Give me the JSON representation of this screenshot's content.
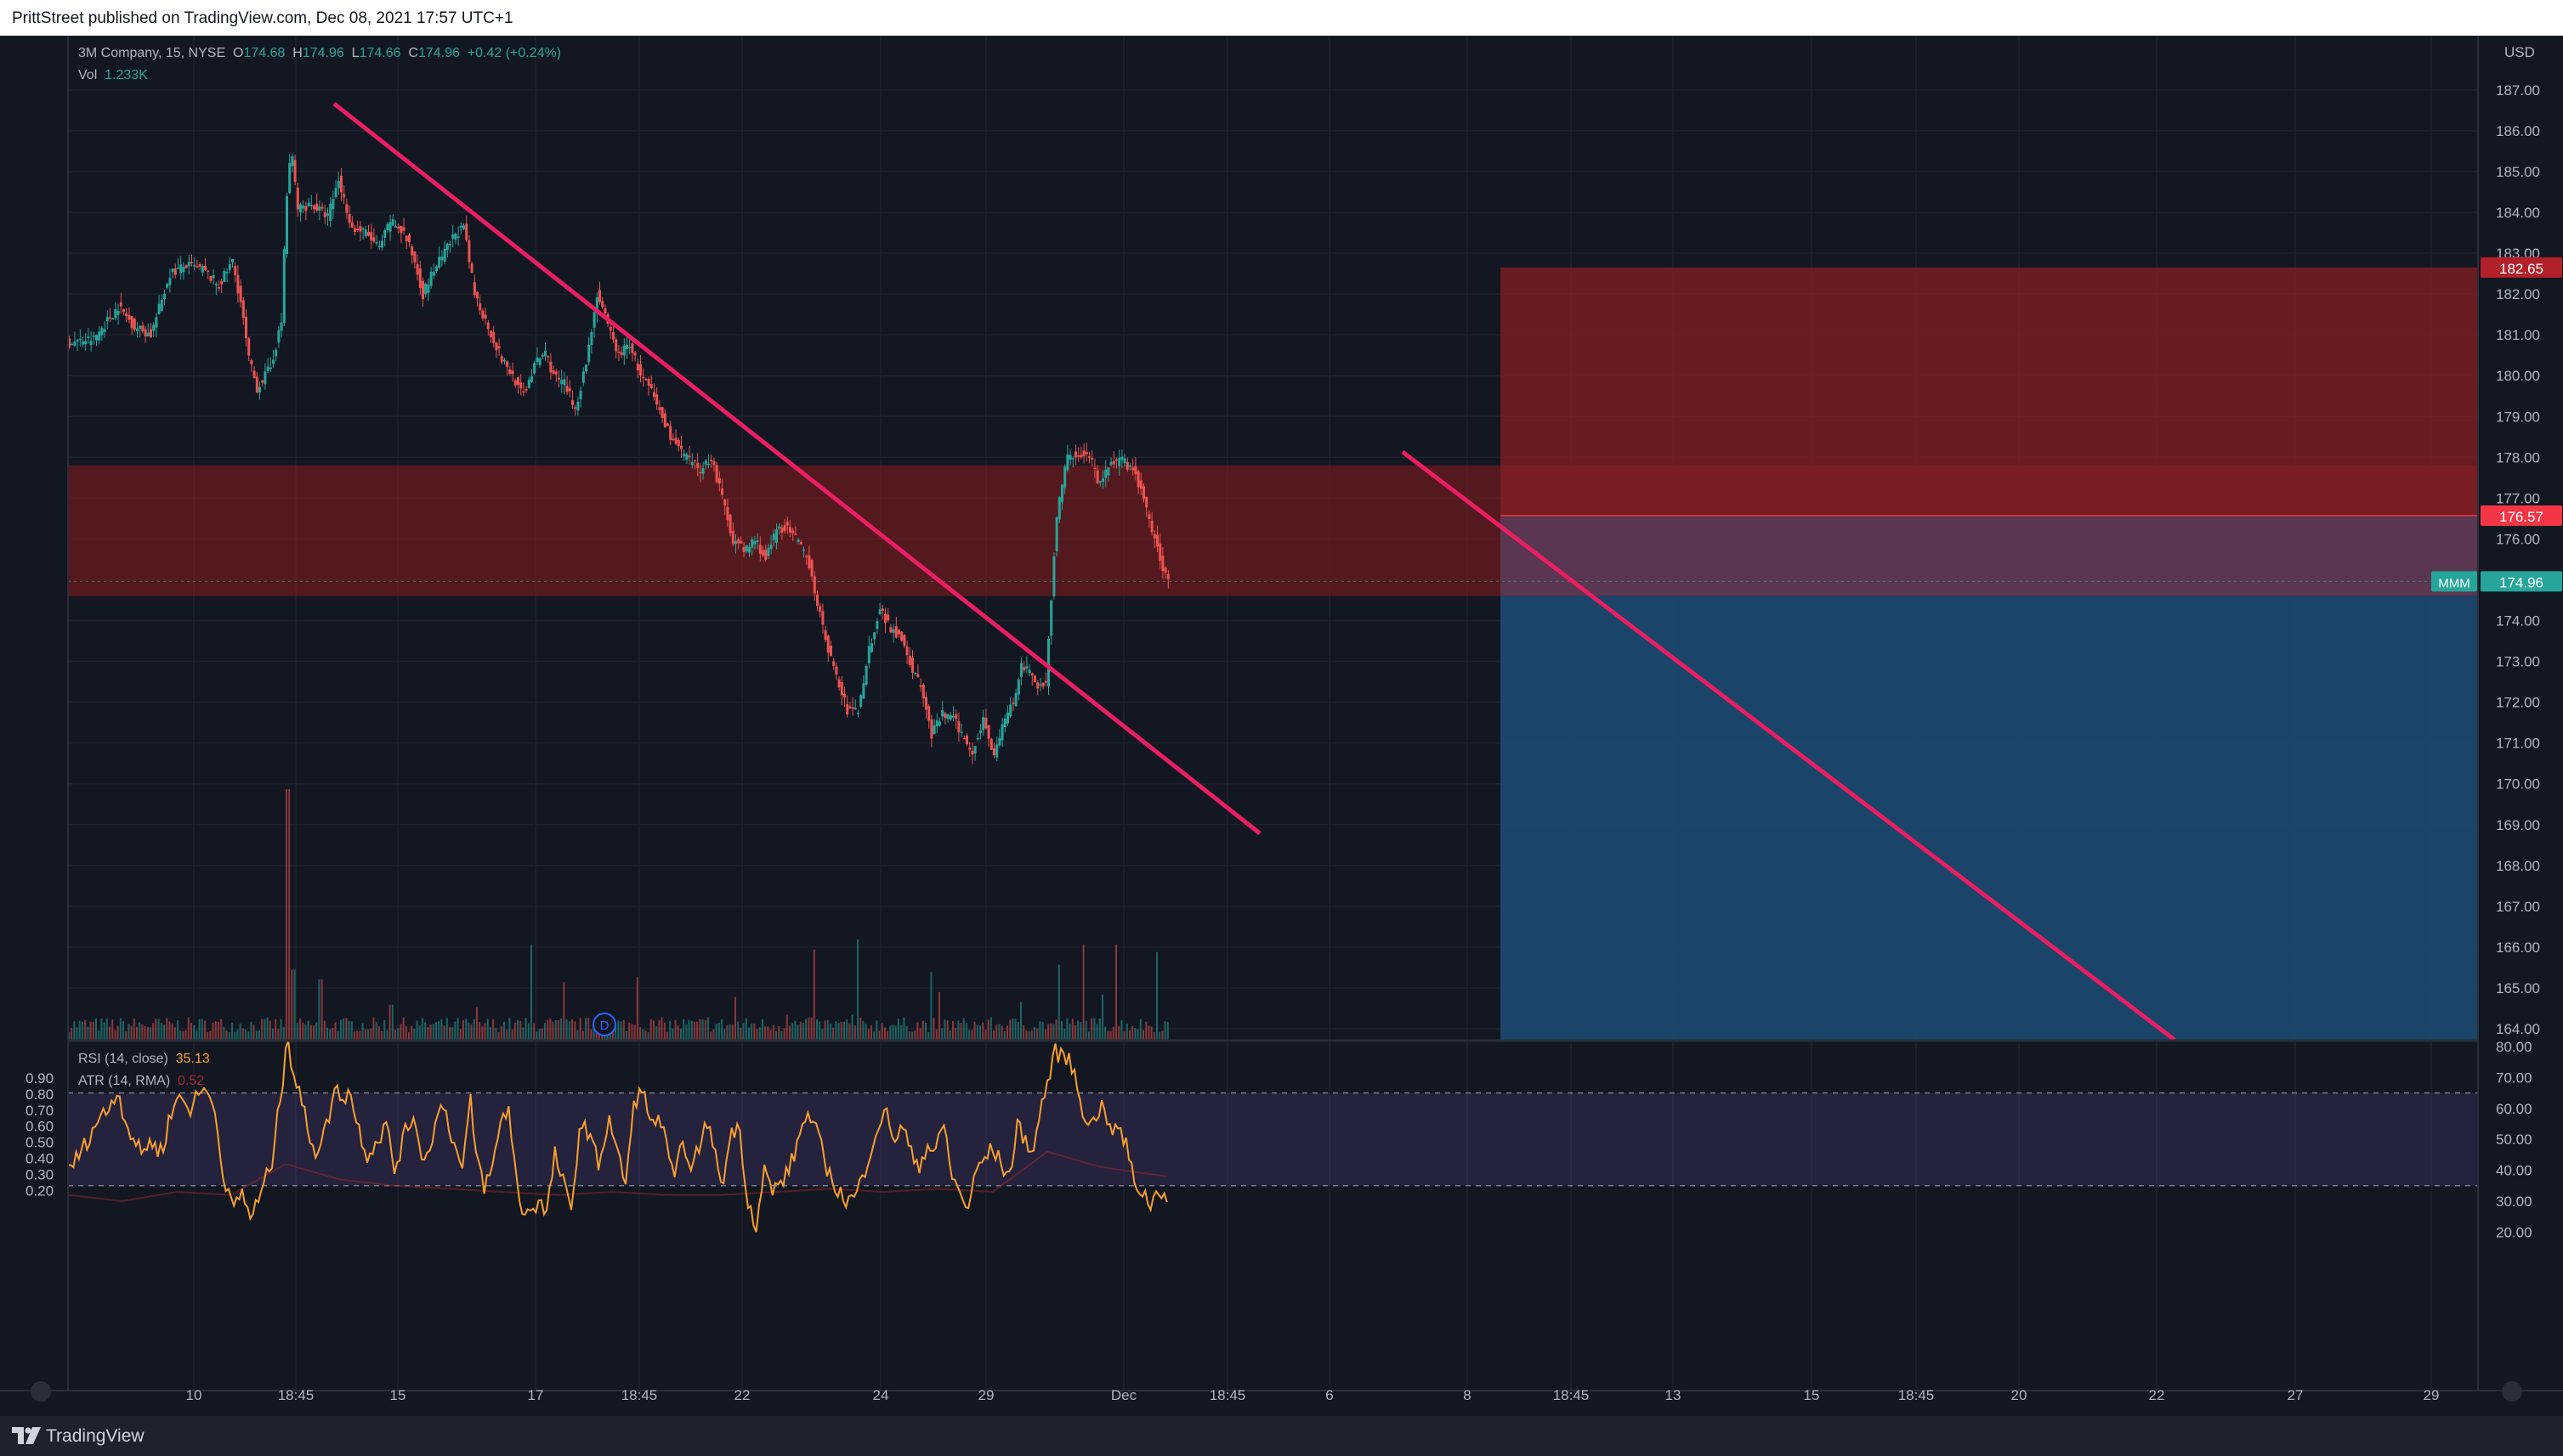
{
  "header": {
    "published": "PrittStreet published on TradingView.com, Dec 08, 2021 17:57 UTC+1"
  },
  "footer": {
    "brand": "TradingView"
  },
  "legend": {
    "symbol_line": "3M Company, 15, NYSE",
    "o_label": "O",
    "o": "174.68",
    "h_label": "H",
    "h": "174.96",
    "l_label": "L",
    "l": "174.66",
    "c_label": "C",
    "c": "174.96",
    "change": "+0.42 (+0.24%)",
    "vol_label": "Vol",
    "vol": "1.233K",
    "rsi_label": "RSI (14, close)",
    "rsi": "35.13",
    "atr_label": "ATR (14, RMA)",
    "atr": "0.52"
  },
  "colors": {
    "up": "#26a69a",
    "down": "#ef5350",
    "trendline": "#e91e63",
    "rsi": "#f7a02d",
    "stop_zone": "#811e24",
    "target_zone": "#1c4a70",
    "resistance_band": "#801a1d"
  },
  "chart_data": {
    "type": "candlestick",
    "symbol": "MMM",
    "currency": "USD",
    "y_range": [
      163.7,
      187.6
    ],
    "price_ticks": [
      "187.00",
      "186.00",
      "185.00",
      "184.00",
      "183.00",
      "182.00",
      "181.00",
      "180.00",
      "179.00",
      "178.00",
      "177.00",
      "176.00",
      "175.00",
      "174.00",
      "173.00",
      "172.00",
      "171.00",
      "170.00",
      "169.00",
      "168.00",
      "167.00",
      "166.00",
      "165.00",
      "164.00"
    ],
    "price_labels": [
      {
        "label": "182.65",
        "price": 182.65,
        "color": "#b2202a"
      },
      {
        "label": "176.57",
        "price": 176.57,
        "color": "#f23645"
      },
      {
        "label": "174.96",
        "price": 174.96,
        "color": "#26a69a",
        "tag": "MMM"
      }
    ],
    "x_ticks": [
      "10",
      "18:45",
      "15",
      "17",
      "18:45",
      "22",
      "24",
      "29",
      "Dec",
      "18:45",
      "6",
      "8",
      "18:45",
      "13",
      "15",
      "18:45",
      "20",
      "22",
      "27",
      "29"
    ],
    "price_path": [
      [
        0,
        180.8
      ],
      [
        20,
        180.9
      ],
      [
        38,
        181.7
      ],
      [
        50,
        181.2
      ],
      [
        62,
        181.0
      ],
      [
        76,
        182.5
      ],
      [
        88,
        182.7
      ],
      [
        100,
        182.6
      ],
      [
        112,
        182.2
      ],
      [
        122,
        182.8
      ],
      [
        128,
        181.8
      ],
      [
        134,
        180.4
      ],
      [
        140,
        179.7
      ],
      [
        150,
        180.2
      ],
      [
        158,
        181.3
      ],
      [
        161,
        184.0
      ],
      [
        165,
        185.6
      ],
      [
        170,
        184.1
      ],
      [
        180,
        184.2
      ],
      [
        192,
        183.9
      ],
      [
        200,
        184.8
      ],
      [
        210,
        183.6
      ],
      [
        220,
        183.5
      ],
      [
        230,
        183.1
      ],
      [
        238,
        183.8
      ],
      [
        248,
        183.5
      ],
      [
        256,
        182.8
      ],
      [
        262,
        182.0
      ],
      [
        270,
        182.6
      ],
      [
        278,
        183.0
      ],
      [
        286,
        183.5
      ],
      [
        292,
        183.6
      ],
      [
        300,
        182.0
      ],
      [
        310,
        181.2
      ],
      [
        320,
        180.4
      ],
      [
        328,
        180.0
      ],
      [
        335,
        179.5
      ],
      [
        345,
        180.3
      ],
      [
        352,
        180.6
      ],
      [
        358,
        180.0
      ],
      [
        366,
        179.8
      ],
      [
        374,
        179.2
      ],
      [
        382,
        180.3
      ],
      [
        390,
        182.0
      ],
      [
        398,
        181.2
      ],
      [
        406,
        180.5
      ],
      [
        414,
        180.8
      ],
      [
        422,
        180.0
      ],
      [
        430,
        179.6
      ],
      [
        440,
        178.8
      ],
      [
        448,
        178.3
      ],
      [
        458,
        177.9
      ],
      [
        466,
        177.7
      ],
      [
        474,
        178.0
      ],
      [
        490,
        176.0
      ],
      [
        498,
        175.7
      ],
      [
        506,
        176.0
      ],
      [
        514,
        175.5
      ],
      [
        522,
        176.2
      ],
      [
        528,
        176.3
      ],
      [
        536,
        176.0
      ],
      [
        546,
        175.4
      ],
      [
        556,
        173.8
      ],
      [
        566,
        172.6
      ],
      [
        574,
        171.8
      ],
      [
        582,
        171.8
      ],
      [
        590,
        173.3
      ],
      [
        598,
        174.3
      ],
      [
        606,
        173.8
      ],
      [
        614,
        173.6
      ],
      [
        622,
        172.8
      ],
      [
        628,
        172.4
      ],
      [
        636,
        171.2
      ],
      [
        644,
        171.7
      ],
      [
        652,
        171.6
      ],
      [
        660,
        171.1
      ],
      [
        666,
        170.8
      ],
      [
        674,
        171.6
      ],
      [
        682,
        170.7
      ],
      [
        690,
        171.6
      ],
      [
        696,
        172.0
      ],
      [
        702,
        172.9
      ],
      [
        708,
        172.7
      ],
      [
        714,
        172.4
      ],
      [
        720,
        172.5
      ],
      [
        728,
        176.6
      ],
      [
        736,
        178.0
      ],
      [
        744,
        178.1
      ],
      [
        752,
        178.0
      ],
      [
        760,
        177.3
      ],
      [
        768,
        177.9
      ],
      [
        776,
        177.9
      ],
      [
        784,
        177.7
      ],
      [
        790,
        177.2
      ],
      [
        796,
        176.4
      ],
      [
        802,
        175.8
      ],
      [
        808,
        175.1
      ]
    ],
    "volume_peaks": [
      [
        161,
        1.0
      ],
      [
        165,
        0.28
      ],
      [
        185,
        0.24
      ],
      [
        237,
        0.14
      ],
      [
        300,
        0.13
      ],
      [
        340,
        0.38
      ],
      [
        364,
        0.23
      ],
      [
        418,
        0.25
      ],
      [
        470,
        0.09
      ],
      [
        490,
        0.17
      ],
      [
        528,
        0.1
      ],
      [
        548,
        0.36
      ],
      [
        576,
        0.1
      ],
      [
        580,
        0.4
      ],
      [
        634,
        0.27
      ],
      [
        640,
        0.19
      ],
      [
        700,
        0.15
      ],
      [
        728,
        0.3
      ],
      [
        746,
        0.38
      ],
      [
        760,
        0.18
      ],
      [
        770,
        0.38
      ],
      [
        800,
        0.35
      ]
    ],
    "rsi_path": [
      [
        0,
        40
      ],
      [
        10,
        46
      ],
      [
        20,
        55
      ],
      [
        30,
        60
      ],
      [
        36,
        66
      ],
      [
        44,
        54
      ],
      [
        54,
        45
      ],
      [
        60,
        50
      ],
      [
        66,
        46
      ],
      [
        70,
        48
      ],
      [
        76,
        59
      ],
      [
        82,
        64
      ],
      [
        90,
        60
      ],
      [
        98,
        66
      ],
      [
        106,
        64
      ],
      [
        112,
        47
      ],
      [
        116,
        33
      ],
      [
        122,
        28
      ],
      [
        128,
        33
      ],
      [
        134,
        25
      ],
      [
        140,
        30
      ],
      [
        150,
        43
      ],
      [
        158,
        70
      ],
      [
        161,
        88
      ],
      [
        164,
        74
      ],
      [
        170,
        65
      ],
      [
        176,
        54
      ],
      [
        182,
        46
      ],
      [
        190,
        54
      ],
      [
        196,
        66
      ],
      [
        202,
        64
      ],
      [
        208,
        65
      ],
      [
        212,
        56
      ],
      [
        220,
        45
      ],
      [
        228,
        50
      ],
      [
        234,
        55
      ],
      [
        240,
        40
      ],
      [
        248,
        52
      ],
      [
        254,
        58
      ],
      [
        262,
        42
      ],
      [
        270,
        55
      ],
      [
        276,
        62
      ],
      [
        284,
        48
      ],
      [
        290,
        40
      ],
      [
        296,
        62
      ],
      [
        300,
        45
      ],
      [
        306,
        35
      ],
      [
        312,
        40
      ],
      [
        318,
        56
      ],
      [
        324,
        60
      ],
      [
        332,
        28
      ],
      [
        340,
        27
      ],
      [
        346,
        30
      ],
      [
        352,
        26
      ],
      [
        358,
        45
      ],
      [
        364,
        36
      ],
      [
        370,
        26
      ],
      [
        376,
        54
      ],
      [
        382,
        53
      ],
      [
        390,
        42
      ],
      [
        398,
        57
      ],
      [
        404,
        45
      ],
      [
        410,
        36
      ],
      [
        416,
        60
      ],
      [
        422,
        68
      ],
      [
        428,
        54
      ],
      [
        434,
        58
      ],
      [
        440,
        48
      ],
      [
        446,
        35
      ],
      [
        452,
        52
      ],
      [
        458,
        38
      ],
      [
        464,
        48
      ],
      [
        470,
        56
      ],
      [
        476,
        44
      ],
      [
        482,
        36
      ],
      [
        488,
        54
      ],
      [
        494,
        52
      ],
      [
        500,
        30
      ],
      [
        506,
        22
      ],
      [
        512,
        40
      ],
      [
        518,
        33
      ],
      [
        524,
        36
      ],
      [
        530,
        40
      ],
      [
        536,
        48
      ],
      [
        542,
        58
      ],
      [
        548,
        55
      ],
      [
        554,
        47
      ],
      [
        560,
        38
      ],
      [
        566,
        34
      ],
      [
        572,
        30
      ],
      [
        578,
        31
      ],
      [
        584,
        37
      ],
      [
        590,
        47
      ],
      [
        596,
        55
      ],
      [
        602,
        58
      ],
      [
        608,
        50
      ],
      [
        614,
        54
      ],
      [
        620,
        45
      ],
      [
        626,
        42
      ],
      [
        632,
        48
      ],
      [
        638,
        46
      ],
      [
        644,
        55
      ],
      [
        650,
        38
      ],
      [
        656,
        32
      ],
      [
        662,
        28
      ],
      [
        668,
        40
      ],
      [
        674,
        44
      ],
      [
        680,
        47
      ],
      [
        686,
        42
      ],
      [
        692,
        38
      ],
      [
        698,
        54
      ],
      [
        704,
        50
      ],
      [
        710,
        46
      ],
      [
        716,
        62
      ],
      [
        720,
        68
      ],
      [
        726,
        78
      ],
      [
        734,
        77
      ],
      [
        740,
        71
      ],
      [
        746,
        60
      ],
      [
        752,
        54
      ],
      [
        756,
        58
      ],
      [
        762,
        62
      ],
      [
        766,
        52
      ],
      [
        772,
        54
      ],
      [
        778,
        48
      ],
      [
        784,
        36
      ],
      [
        790,
        33
      ],
      [
        796,
        29
      ],
      [
        802,
        34
      ],
      [
        808,
        32
      ]
    ],
    "atr_path": [
      [
        0,
        32
      ],
      [
        40,
        30
      ],
      [
        80,
        33
      ],
      [
        120,
        32
      ],
      [
        160,
        42
      ],
      [
        200,
        37
      ],
      [
        240,
        35
      ],
      [
        280,
        34
      ],
      [
        320,
        33
      ],
      [
        360,
        32
      ],
      [
        400,
        33
      ],
      [
        440,
        32
      ],
      [
        480,
        32
      ],
      [
        520,
        33
      ],
      [
        560,
        34
      ],
      [
        600,
        33
      ],
      [
        640,
        34
      ],
      [
        680,
        33
      ],
      [
        720,
        46
      ],
      [
        760,
        41
      ],
      [
        808,
        38
      ]
    ]
  }
}
